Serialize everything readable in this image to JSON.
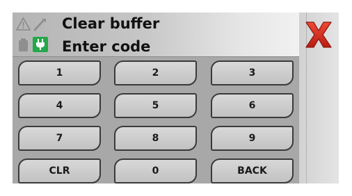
{
  "header": {
    "line1": "Clear buffer",
    "line2": "Enter code"
  },
  "status_icons": {
    "warning": "warning-triangle-icon",
    "tool": "wrench-icon",
    "battery": "battery-icon",
    "power": "power-plug-icon"
  },
  "close": {
    "icon": "red-x-icon",
    "color": "#cc2a1c"
  },
  "colors": {
    "plug_active": "#23a84a",
    "panel": "#a8a8a8"
  },
  "keypad": {
    "keys": [
      "1",
      "2",
      "3",
      "4",
      "5",
      "6",
      "7",
      "8",
      "9",
      "CLR",
      "0",
      "BACK"
    ]
  }
}
